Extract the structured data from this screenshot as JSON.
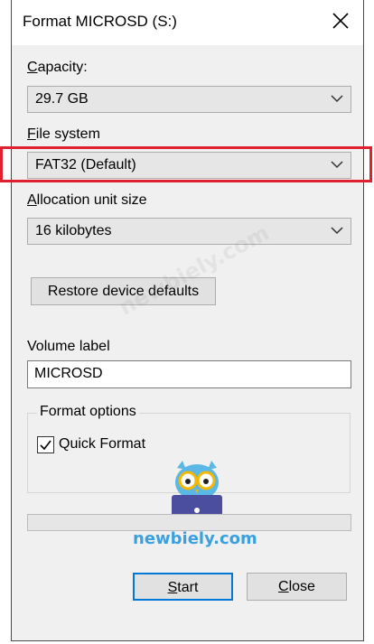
{
  "window": {
    "title": "Format MICROSD (S:)"
  },
  "capacity": {
    "label": "Capacity:",
    "value": "29.7 GB"
  },
  "file_system": {
    "label": "File system",
    "value": "FAT32 (Default)"
  },
  "allocation": {
    "label": "Allocation unit size",
    "value": "16 kilobytes"
  },
  "restore_button": {
    "label": "Restore device defaults"
  },
  "volume": {
    "label": "Volume label",
    "value": "MICROSD"
  },
  "format_options": {
    "legend": "Format options",
    "quick_format_label": "Quick Format",
    "quick_format_checked": true
  },
  "progress": {
    "value": 0
  },
  "buttons": {
    "start": "Start",
    "close": "Close"
  },
  "watermark": {
    "text": "newbiely.com"
  },
  "colors": {
    "highlight": "#e0202e",
    "accent": "#0078d7",
    "watermark": "#3aa0e0"
  }
}
